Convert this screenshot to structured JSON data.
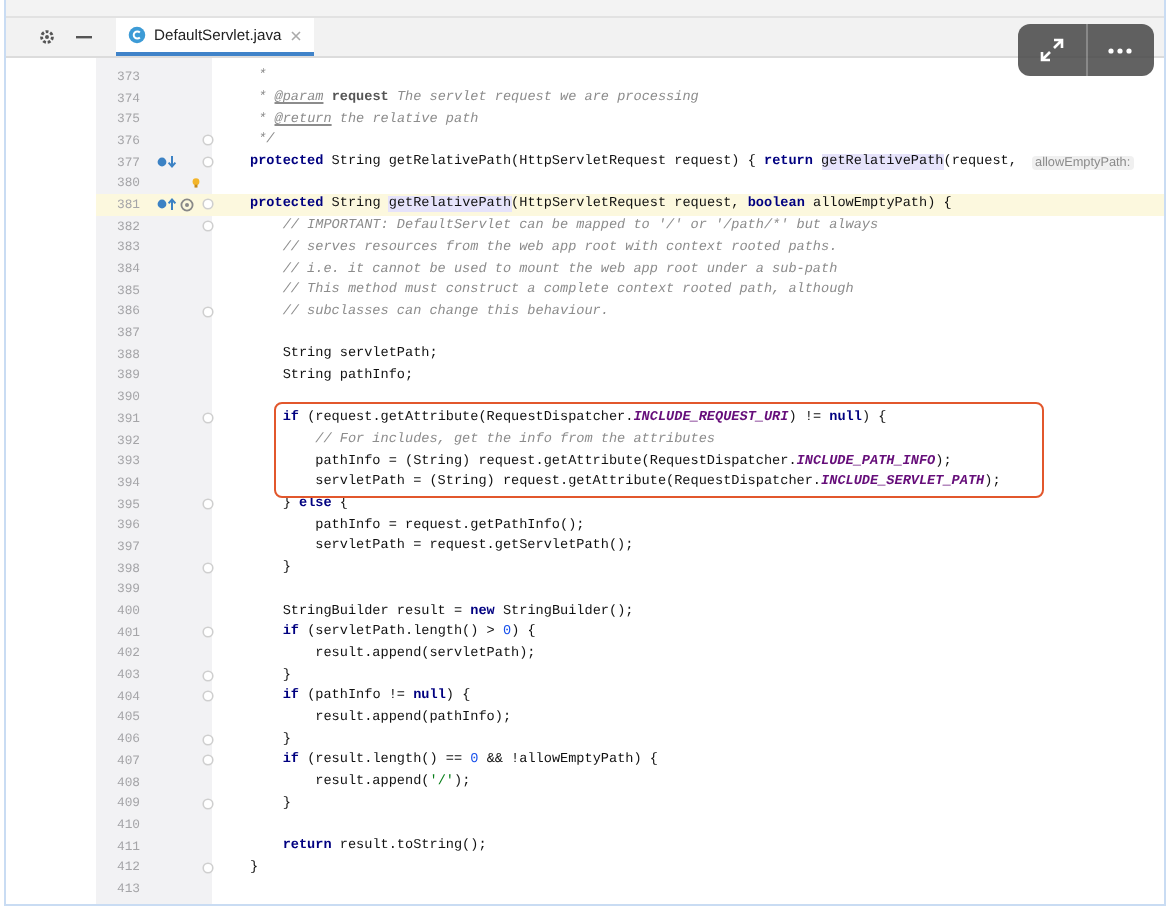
{
  "tab": {
    "title": "DefaultServlet.java",
    "selected": true
  },
  "lines": [
    {
      "number": "373",
      "current": false,
      "boxed": false,
      "fold": false,
      "tokens": [
        {
          "kind": "doc",
          "text": " *"
        }
      ]
    },
    {
      "number": "374",
      "current": false,
      "boxed": false,
      "fold": false,
      "tokens": [
        {
          "kind": "doc",
          "text": " * "
        },
        {
          "kind": "doctag",
          "text": "@param"
        },
        {
          "kind": "docbold",
          "text": " request"
        },
        {
          "kind": "doc",
          "text": " The servlet request we are processing"
        }
      ]
    },
    {
      "number": "375",
      "current": false,
      "boxed": false,
      "fold": false,
      "tokens": [
        {
          "kind": "doc",
          "text": " * "
        },
        {
          "kind": "doctag",
          "text": "@return"
        },
        {
          "kind": "doc",
          "text": " the relative path"
        }
      ]
    },
    {
      "number": "376",
      "current": false,
      "boxed": false,
      "fold": true,
      "tokens": [
        {
          "kind": "doc",
          "text": " */"
        }
      ]
    },
    {
      "number": "377",
      "gutter_icons": [
        {
          "kind": "implemented"
        }
      ],
      "current": false,
      "boxed": false,
      "fold": true,
      "tokens": [
        {
          "kind": "kw",
          "text": "protected"
        },
        {
          "kind": "plain",
          "text": " String getRelativePath(HttpServletRequest request) { "
        },
        {
          "kind": "kw",
          "text": "return "
        },
        {
          "kind": "ref",
          "text": "getRelativePath"
        },
        {
          "kind": "plain",
          "text": "(request, "
        },
        {
          "kind": "hint",
          "text": "allowEmptyPath:"
        }
      ]
    },
    {
      "number": "380",
      "gutter_icons": [
        {
          "kind": "bulb"
        }
      ],
      "current": false,
      "boxed": false,
      "fold": false
    },
    {
      "number": "381",
      "gutter_icons": [
        {
          "kind": "overriding"
        },
        {
          "kind": "annotation"
        }
      ],
      "current": true,
      "boxed": false,
      "fold": true,
      "tokens": [
        {
          "kind": "kw",
          "text": "protected"
        },
        {
          "kind": "plain",
          "text": " String "
        },
        {
          "kind": "ref",
          "text": "getRelativePath"
        },
        {
          "kind": "plain",
          "text": "(HttpServletRequest request, "
        },
        {
          "kind": "kw",
          "text": "boolean"
        },
        {
          "kind": "plain",
          "text": " allowEmptyPath) {"
        }
      ]
    },
    {
      "number": "382",
      "current": false,
      "boxed": false,
      "fold": true,
      "tokens": [
        {
          "kind": "comment",
          "text": "    // IMPORTANT: DefaultServlet can be mapped to '/' or '/path/*' but always"
        }
      ]
    },
    {
      "number": "383",
      "current": false,
      "boxed": false,
      "fold": false,
      "tokens": [
        {
          "kind": "comment",
          "text": "    // serves resources from the web app root with context rooted paths."
        }
      ]
    },
    {
      "number": "384",
      "current": false,
      "boxed": false,
      "fold": false,
      "tokens": [
        {
          "kind": "comment",
          "text": "    // i.e. it cannot be used to mount the web app root under a sub-path"
        }
      ]
    },
    {
      "number": "385",
      "current": false,
      "boxed": false,
      "fold": false,
      "tokens": [
        {
          "kind": "comment",
          "text": "    // This method must construct a complete context rooted path, although"
        }
      ]
    },
    {
      "number": "386",
      "current": false,
      "boxed": false,
      "fold": true,
      "tokens": [
        {
          "kind": "comment",
          "text": "    // subclasses can change this behaviour."
        }
      ]
    },
    {
      "number": "387",
      "current": false,
      "boxed": false,
      "fold": false
    },
    {
      "number": "388",
      "current": false,
      "boxed": false,
      "fold": false,
      "tokens": [
        {
          "kind": "plain",
          "text": "    String servletPath;"
        }
      ]
    },
    {
      "number": "389",
      "current": false,
      "boxed": false,
      "fold": false,
      "tokens": [
        {
          "kind": "plain",
          "text": "    String pathInfo;"
        }
      ]
    },
    {
      "number": "390",
      "current": false,
      "boxed": false,
      "fold": false
    },
    {
      "number": "391",
      "current": false,
      "boxed": true,
      "fold": true,
      "tokens": [
        {
          "kind": "kw",
          "text": "    if"
        },
        {
          "kind": "plain",
          "text": " (request.getAttribute(RequestDispatcher."
        },
        {
          "kind": "const",
          "text": "INCLUDE_REQUEST_URI"
        },
        {
          "kind": "plain",
          "text": ") != "
        },
        {
          "kind": "kw",
          "text": "null"
        },
        {
          "kind": "plain",
          "text": ") {"
        }
      ]
    },
    {
      "number": "392",
      "current": false,
      "boxed": true,
      "fold": false,
      "tokens": [
        {
          "kind": "comment",
          "text": "        // For includes, get the info from the attributes"
        }
      ]
    },
    {
      "number": "393",
      "current": false,
      "boxed": true,
      "fold": false,
      "tokens": [
        {
          "kind": "plain",
          "text": "        pathInfo = (String) request.getAttribute(RequestDispatcher."
        },
        {
          "kind": "const",
          "text": "INCLUDE_PATH_INFO"
        },
        {
          "kind": "plain",
          "text": ");"
        }
      ]
    },
    {
      "number": "394",
      "current": false,
      "boxed": true,
      "fold": false,
      "tokens": [
        {
          "kind": "plain",
          "text": "        servletPath = (String) request.getAttribute(RequestDispatcher."
        },
        {
          "kind": "const",
          "text": "INCLUDE_SERVLET_PATH"
        },
        {
          "kind": "plain",
          "text": ");"
        }
      ]
    },
    {
      "number": "395",
      "current": false,
      "boxed": false,
      "fold": true,
      "tokens": [
        {
          "kind": "plain",
          "text": "    } "
        },
        {
          "kind": "kw",
          "text": "else"
        },
        {
          "kind": "plain",
          "text": " {"
        }
      ]
    },
    {
      "number": "396",
      "current": false,
      "boxed": false,
      "fold": false,
      "tokens": [
        {
          "kind": "plain",
          "text": "        pathInfo = request.getPathInfo();"
        }
      ]
    },
    {
      "number": "397",
      "current": false,
      "boxed": false,
      "fold": false,
      "tokens": [
        {
          "kind": "plain",
          "text": "        servletPath = request.getServletPath();"
        }
      ]
    },
    {
      "number": "398",
      "current": false,
      "boxed": false,
      "fold": true,
      "tokens": [
        {
          "kind": "plain",
          "text": "    }"
        }
      ]
    },
    {
      "number": "399",
      "current": false,
      "boxed": false,
      "fold": false
    },
    {
      "number": "400",
      "current": false,
      "boxed": false,
      "fold": false,
      "tokens": [
        {
          "kind": "plain",
          "text": "    StringBuilder result = "
        },
        {
          "kind": "kw",
          "text": "new"
        },
        {
          "kind": "plain",
          "text": " StringBuilder();"
        }
      ]
    },
    {
      "number": "401",
      "current": false,
      "boxed": false,
      "fold": true,
      "tokens": [
        {
          "kind": "kw",
          "text": "    if"
        },
        {
          "kind": "plain",
          "text": " (servletPath.length() > "
        },
        {
          "kind": "num",
          "text": "0"
        },
        {
          "kind": "plain",
          "text": ") {"
        }
      ]
    },
    {
      "number": "402",
      "current": false,
      "boxed": false,
      "fold": false,
      "tokens": [
        {
          "kind": "plain",
          "text": "        result.append(servletPath);"
        }
      ]
    },
    {
      "number": "403",
      "current": false,
      "boxed": false,
      "fold": true,
      "tokens": [
        {
          "kind": "plain",
          "text": "    }"
        }
      ]
    },
    {
      "number": "404",
      "current": false,
      "boxed": false,
      "fold": true,
      "tokens": [
        {
          "kind": "kw",
          "text": "    if"
        },
        {
          "kind": "plain",
          "text": " (pathInfo != "
        },
        {
          "kind": "kw",
          "text": "null"
        },
        {
          "kind": "plain",
          "text": ") {"
        }
      ]
    },
    {
      "number": "405",
      "current": false,
      "boxed": false,
      "fold": false,
      "tokens": [
        {
          "kind": "plain",
          "text": "        result.append(pathInfo);"
        }
      ]
    },
    {
      "number": "406",
      "current": false,
      "boxed": false,
      "fold": true,
      "tokens": [
        {
          "kind": "plain",
          "text": "    }"
        }
      ]
    },
    {
      "number": "407",
      "current": false,
      "boxed": false,
      "fold": true,
      "tokens": [
        {
          "kind": "kw",
          "text": "    if"
        },
        {
          "kind": "plain",
          "text": " (result.length() == "
        },
        {
          "kind": "num",
          "text": "0"
        },
        {
          "kind": "plain",
          "text": " && !allowEmptyPath) {"
        }
      ]
    },
    {
      "number": "408",
      "current": false,
      "boxed": false,
      "fold": false,
      "tokens": [
        {
          "kind": "plain",
          "text": "        result.append("
        },
        {
          "kind": "str",
          "text": "'/'"
        },
        {
          "kind": "plain",
          "text": ");"
        }
      ]
    },
    {
      "number": "409",
      "current": false,
      "boxed": false,
      "fold": true,
      "tokens": [
        {
          "kind": "plain",
          "text": "    }"
        }
      ]
    },
    {
      "number": "410",
      "current": false,
      "boxed": false,
      "fold": false
    },
    {
      "number": "411",
      "current": false,
      "boxed": false,
      "fold": false,
      "tokens": [
        {
          "kind": "kw",
          "text": "    return"
        },
        {
          "kind": "plain",
          "text": " result.toString();"
        }
      ]
    },
    {
      "number": "412",
      "current": false,
      "boxed": false,
      "fold": true,
      "tokens": [
        {
          "kind": "plain",
          "text": "}"
        }
      ]
    },
    {
      "number": "413",
      "current": false,
      "boxed": false,
      "fold": false
    }
  ]
}
